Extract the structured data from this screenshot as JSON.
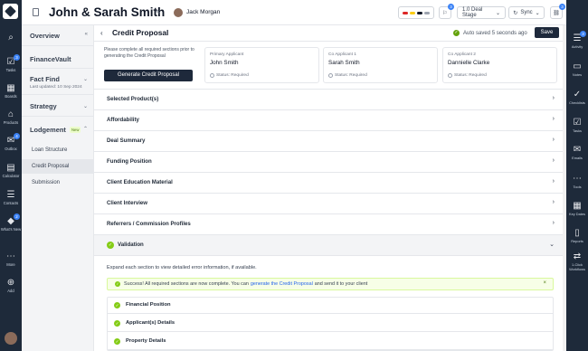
{
  "header": {
    "title": "John & Sarah Smith",
    "username": "Jack Morgan",
    "notif_count": "3",
    "deal_stage": "1.0 Deal Stage",
    "sync_label": "Sync",
    "link_count": "3",
    "status_colors": [
      "#dc2626",
      "#facc15",
      "#111827",
      "#9ca3af"
    ]
  },
  "leftnav": {
    "items": [
      {
        "icon": "search-icon",
        "glyph": "⌕",
        "label": ""
      },
      {
        "icon": "tasks-icon",
        "glyph": "☑",
        "label": "Tasks",
        "badge": "3"
      },
      {
        "icon": "boards-icon",
        "glyph": "▦",
        "label": "Boards"
      },
      {
        "icon": "products-icon",
        "glyph": "⌂",
        "label": "Products"
      },
      {
        "icon": "outbox-icon",
        "glyph": "✉",
        "label": "Outbox",
        "badge": "4"
      },
      {
        "icon": "calculator-icon",
        "glyph": "▤",
        "label": "Calculator"
      },
      {
        "icon": "contacts-icon",
        "glyph": "☰",
        "label": "Contacts"
      },
      {
        "icon": "whats-new-icon",
        "glyph": "◆",
        "label": "What's New",
        "badge": "2"
      },
      {
        "icon": "more-icon",
        "glyph": "⋯",
        "label": "More"
      },
      {
        "icon": "add-icon",
        "glyph": "⊕",
        "label": "Add"
      }
    ]
  },
  "rightnav": {
    "items": [
      {
        "icon": "activity-icon",
        "glyph": "☰",
        "label": "Activity",
        "badge": "3"
      },
      {
        "icon": "notes-icon",
        "glyph": "▭",
        "label": "Notes"
      },
      {
        "icon": "checklists-icon",
        "glyph": "✓",
        "label": "Checklists"
      },
      {
        "icon": "tasks-icon",
        "glyph": "☑",
        "label": "Tasks"
      },
      {
        "icon": "emails-icon",
        "glyph": "✉",
        "label": "Emails"
      },
      {
        "icon": "tools-icon",
        "glyph": "⋯",
        "label": "Tools"
      },
      {
        "icon": "key-dates-icon",
        "glyph": "▦",
        "label": "Key Dates"
      },
      {
        "icon": "reports-icon",
        "glyph": "▯",
        "label": "Reports"
      },
      {
        "icon": "workflows-icon",
        "glyph": "⇄",
        "label": "1-Click Workflows"
      }
    ]
  },
  "sidebar": {
    "overview": "Overview",
    "financevault": "FinanceVault",
    "factfind": "Fact Find",
    "factfind_updated": "Last updated: 10 Sep 2024",
    "strategy": "Strategy",
    "lodgement": "Lodgement",
    "new_tag": "New",
    "lodgement_items": [
      "Loan Structure",
      "Credit Proposal",
      "Submission"
    ]
  },
  "main": {
    "title": "Credit Proposal",
    "autosave": "Auto saved 5 seconds ago",
    "save_label": "Save",
    "note": "Please complete all required sections prior to generating the Credit Proposal",
    "generate_label": "Generate Credit Proposal",
    "applicants": [
      {
        "role": "Primary Applicant",
        "name": "John Smith",
        "status": "Status: Required"
      },
      {
        "role": "Co Applicant 1",
        "name": "Sarah Smith",
        "status": "Status: Required"
      },
      {
        "role": "Co Applicant 2",
        "name": "Dannielle Clarke",
        "status": "Status: Required"
      }
    ],
    "sections": [
      "Selected Product(s)",
      "Affordability",
      "Deal Summary",
      "Funding Position",
      "Client Education Material",
      "Client Interview",
      "Referrers / Commission Profiles"
    ],
    "validation_label": "Validation",
    "expand_text": "Expand each section to view detailed error information, if available.",
    "success_prefix": "Success! All required sections are now complete. You can",
    "success_link": "generate the Credit Proposal",
    "success_suffix": "and send it to your client",
    "close_glyph": "×",
    "validation_items": [
      "Financial Position",
      "Applicant(s) Details",
      "Property Details"
    ]
  }
}
